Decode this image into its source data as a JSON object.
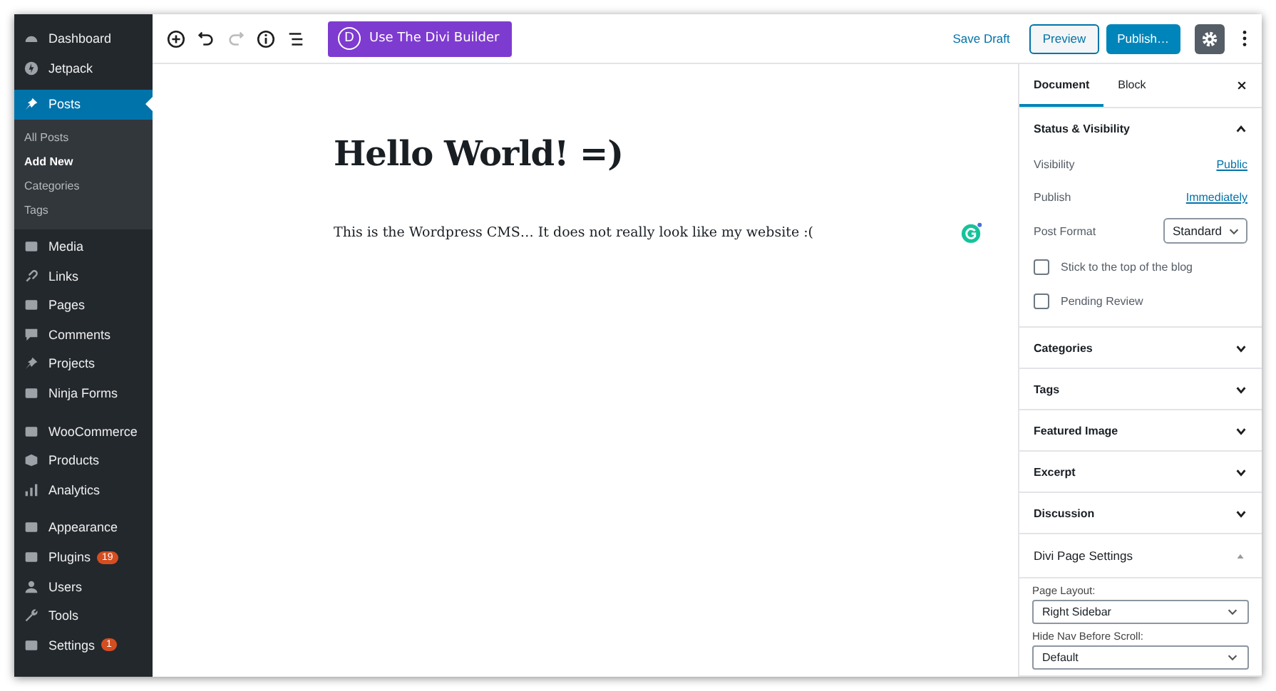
{
  "admin_menu": {
    "groups": [
      {
        "items": [
          {
            "label": "Dashboard",
            "selected": false
          },
          {
            "label": "Jetpack",
            "selected": false
          }
        ]
      },
      {
        "items": [
          {
            "label": "Posts",
            "selected": true,
            "expanded": true,
            "children": [
              {
                "label": "All Posts",
                "selected": false
              },
              {
                "label": "Add New",
                "selected": true
              },
              {
                "label": "Categories",
                "selected": false
              },
              {
                "label": "Tags",
                "selected": false
              }
            ]
          },
          {
            "label": "Media",
            "selected": false
          },
          {
            "label": "Links",
            "selected": false
          },
          {
            "label": "Pages",
            "selected": false
          },
          {
            "label": "Comments",
            "selected": false
          },
          {
            "label": "Projects",
            "selected": false
          },
          {
            "label": "Ninja Forms",
            "selected": false
          }
        ]
      },
      {
        "items": [
          {
            "label": "WooCommerce",
            "selected": false
          },
          {
            "label": "Products",
            "selected": false
          },
          {
            "label": "Analytics",
            "selected": false
          }
        ]
      },
      {
        "items": [
          {
            "label": "Appearance",
            "selected": false
          },
          {
            "label": "Plugins",
            "selected": false,
            "badge": "19"
          },
          {
            "label": "Users",
            "selected": false
          },
          {
            "label": "Tools",
            "selected": false
          },
          {
            "label": "Settings",
            "selected": false,
            "badge": "1"
          }
        ]
      }
    ]
  },
  "toolbar": {
    "divi_button": "Use The Divi Builder",
    "divi_logo": "D",
    "save_draft": "Save Draft",
    "preview": "Preview",
    "publish": "Publish…"
  },
  "editor": {
    "title": "Hello World! =)",
    "paragraph": "This is the Wordpress CMS… It does not really look like my website :("
  },
  "settings_panel": {
    "tabs": [
      {
        "label": "Document",
        "selected": true
      },
      {
        "label": "Block",
        "selected": false
      }
    ],
    "sections": [
      {
        "kind": "status",
        "title": "Status & Visibility",
        "expanded": true,
        "rows": [
          {
            "label": "Visibility",
            "link": "Public"
          },
          {
            "label": "Publish",
            "link": "Immediately"
          }
        ],
        "post_format": {
          "label": "Post Format",
          "value": "Standard"
        },
        "checkboxes": [
          {
            "label": "Stick to the top of the blog",
            "checked": false
          },
          {
            "label": "Pending Review",
            "checked": false
          }
        ]
      },
      {
        "kind": "plain",
        "title": "Categories",
        "expanded": false
      },
      {
        "kind": "plain",
        "title": "Tags",
        "expanded": false
      },
      {
        "kind": "plain",
        "title": "Featured Image",
        "expanded": false
      },
      {
        "kind": "plain",
        "title": "Excerpt",
        "expanded": false
      },
      {
        "kind": "plain",
        "title": "Discussion",
        "expanded": false
      },
      {
        "kind": "divi",
        "title": "Divi Page Settings",
        "expanded": true,
        "fields": [
          {
            "label": "Page Layout:",
            "value": "Right Sidebar"
          },
          {
            "label": "Hide Nav Before Scroll:",
            "value": "Default"
          }
        ]
      }
    ]
  }
}
